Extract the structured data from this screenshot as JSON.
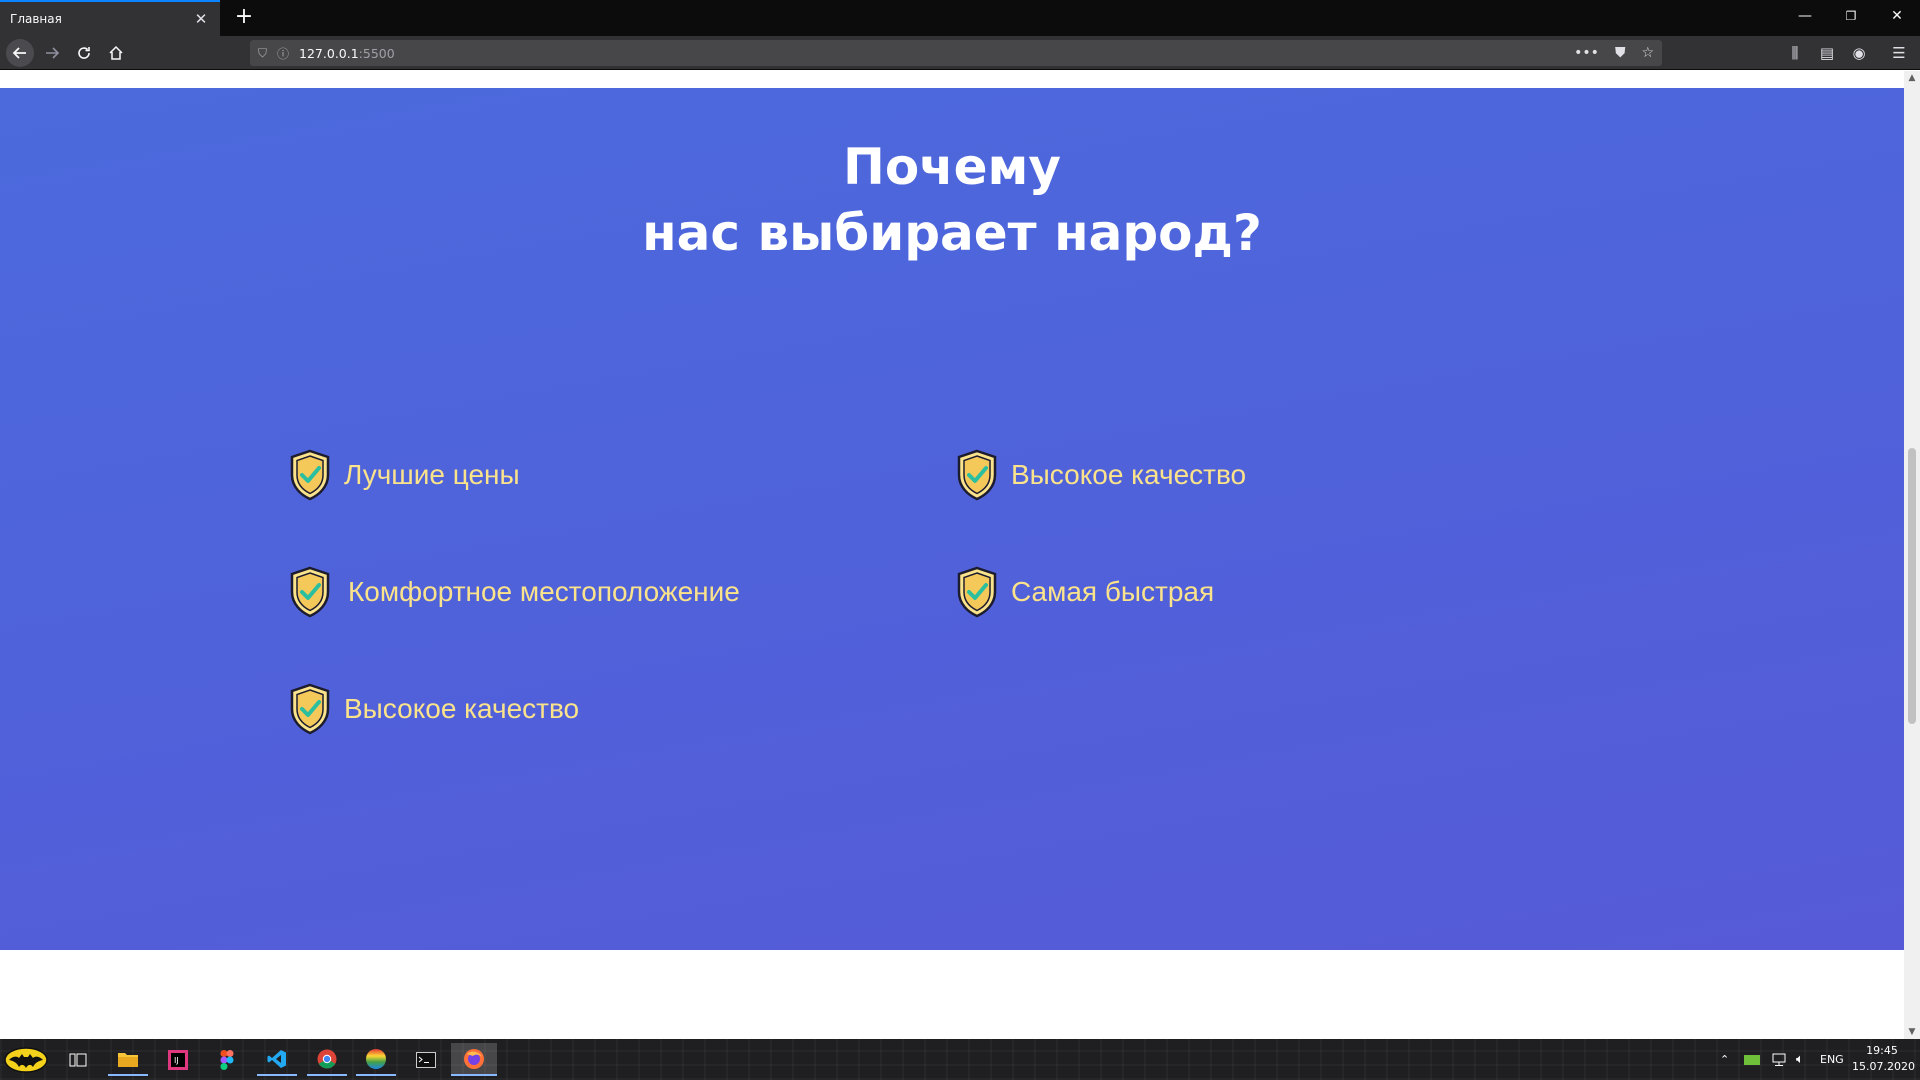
{
  "browser": {
    "tab_title": "Главная",
    "tab_close": "✕",
    "new_tab": "+",
    "url_host": "127.0.0.1",
    "url_port": ":5500",
    "window_controls": {
      "minimize": "—",
      "restore": "❐",
      "close": "✕"
    }
  },
  "hero": {
    "title_line1": "Почему",
    "title_line2": "нас выбирает народ?",
    "features": [
      {
        "label": "Лучшие цены",
        "icon": "shield-check-icon"
      },
      {
        "label": "Высокое качество",
        "icon": "shield-check-icon"
      },
      {
        "label": "Комфортное местоположение",
        "icon": "shield-check-icon"
      },
      {
        "label": "Самая быстрая",
        "icon": "shield-check-icon"
      },
      {
        "label": "Высокое качество",
        "icon": "shield-check-icon"
      }
    ],
    "colors": {
      "bg_top": "#4c6adc",
      "bg_bottom": "#565ad6",
      "feature_text": "#fbe38b",
      "shield_fill": "#fbe38b",
      "check": "#2bbfa0"
    }
  },
  "taskbar": {
    "lang": "ENG",
    "time": "19:45",
    "date": "15.07.2020"
  }
}
